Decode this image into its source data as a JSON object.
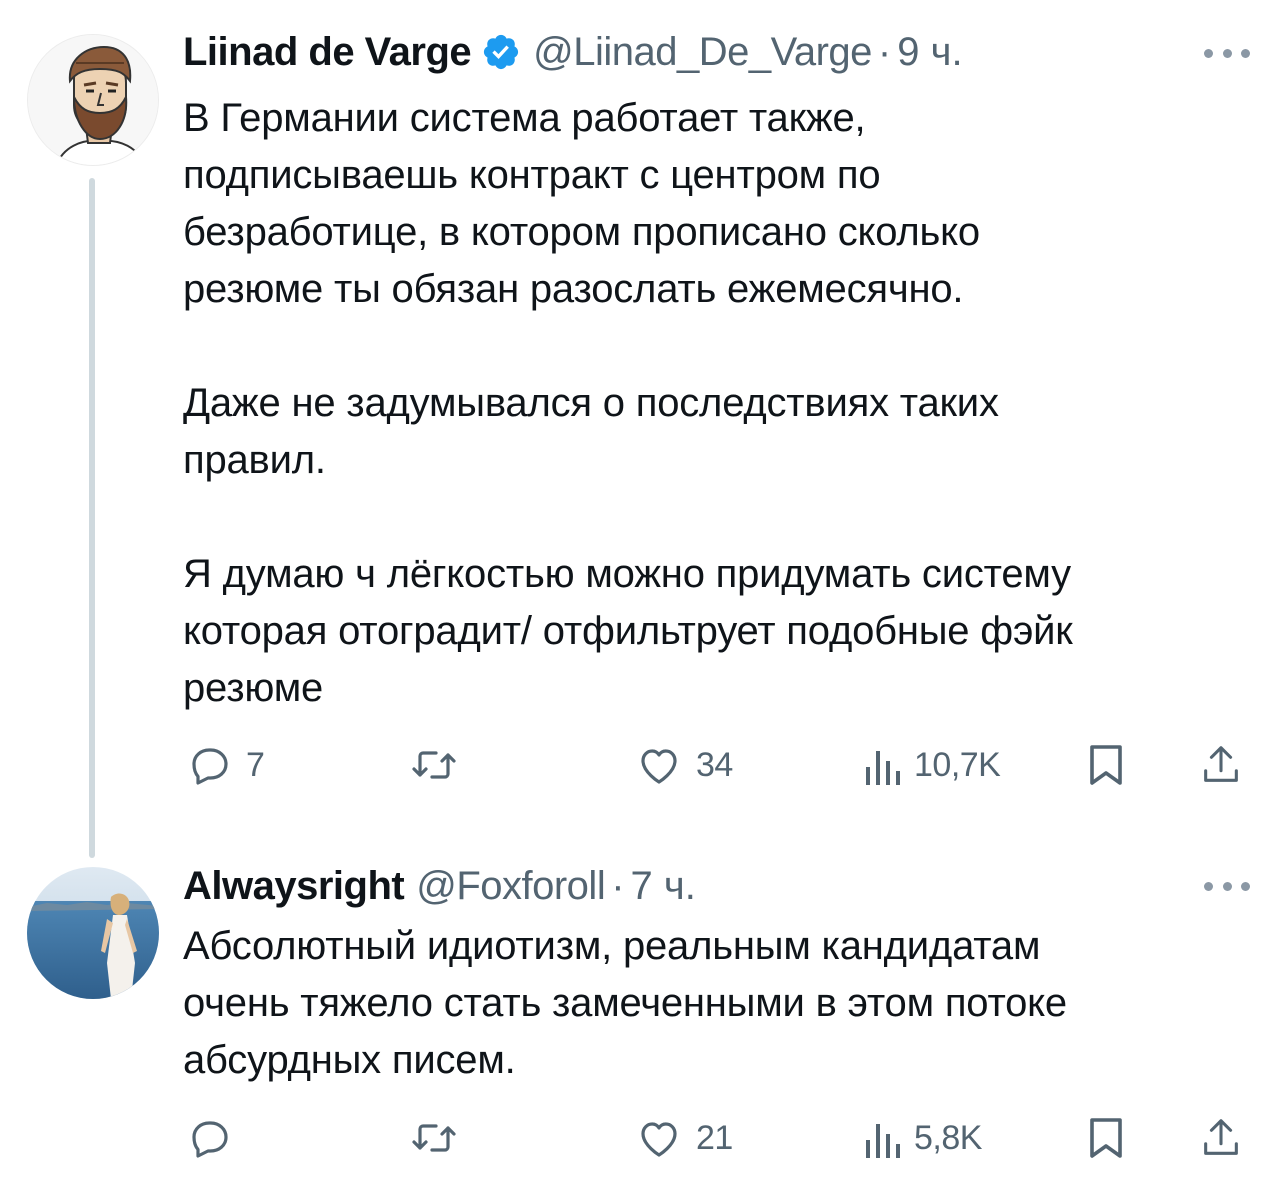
{
  "tweets": [
    {
      "author": {
        "display_name": "Liinad de Varge",
        "handle": "@Liinad_De_Varge",
        "verified": true,
        "avatar": "bearded-man-drawing-avatar"
      },
      "separator": "·",
      "time": "9 ч.",
      "paragraphs": [
        "В Германии система работает также,\nподписываешь контракт с центром по\nбезработице, в котором прописано сколько\nрезюме ты обязан разослать ежемесячно.",
        "Даже не задумывался о последствиях таких\nправил.",
        "Я думаю ч лёгкостью можно придумать систему\nкоторая отоградит/ отфильтрует подобные фэйк\nрезюме"
      ],
      "actions": {
        "replies": "7",
        "retweets": "",
        "likes": "34",
        "views": "10,7K"
      }
    },
    {
      "author": {
        "display_name": "Alwaysright",
        "handle": "@Foxforoll",
        "verified": false,
        "avatar": "woman-by-sea-photo-avatar"
      },
      "separator": "·",
      "time": "7 ч.",
      "paragraphs": [
        "Абсолютный идиотизм, реальным кандидатам\nочень тяжело стать замеченными в этом потоке\nабсурдных писем."
      ],
      "actions": {
        "replies": "",
        "retweets": "",
        "likes": "21",
        "views": "5,8K"
      }
    }
  ],
  "colors": {
    "text": "#0f1419",
    "secondary": "#536471",
    "verified": "#1d9bf0",
    "thread_line": "#cfd9de"
  },
  "icons": [
    "reply-icon",
    "retweet-icon",
    "like-icon",
    "views-icon",
    "bookmark-icon",
    "share-icon",
    "more-icon",
    "verified-badge-icon"
  ]
}
